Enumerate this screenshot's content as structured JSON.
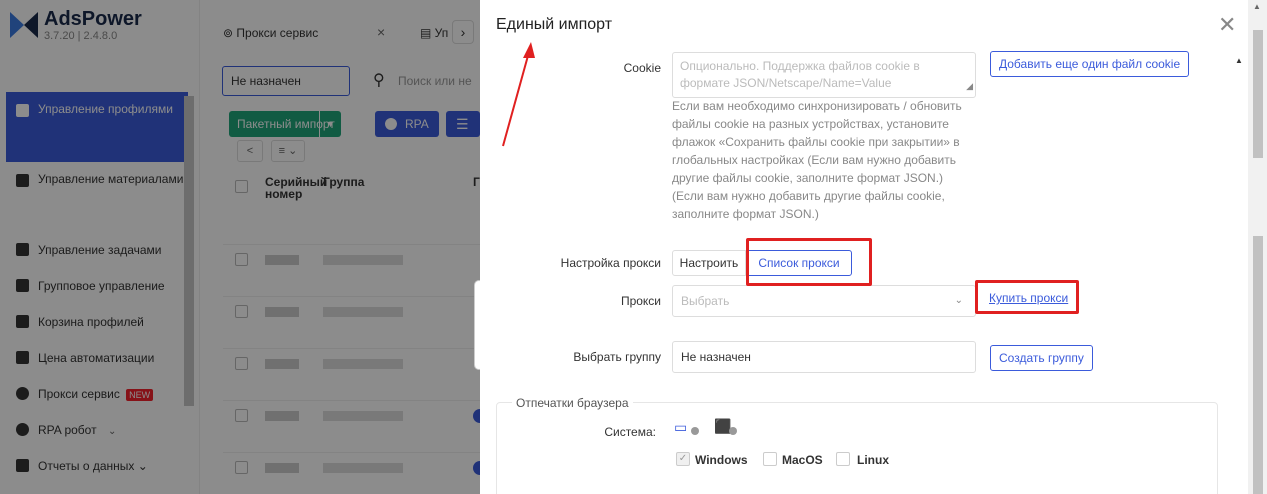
{
  "app": {
    "name": "AdsPower",
    "version": "3.7.20 | 2.4.8.0"
  },
  "sidebar": {
    "items": [
      {
        "label": "Управление профилями",
        "icon": "profile-icon",
        "active": true
      },
      {
        "label": "Управление материалами",
        "icon": "folder-icon"
      },
      {
        "label": "Управление задачами",
        "icon": "tasks-icon"
      },
      {
        "label": "Групповое управление",
        "icon": "group-icon"
      },
      {
        "label": "Корзина профилей",
        "icon": "trash-icon"
      },
      {
        "label": "Цена автоматизации",
        "icon": "price-icon"
      },
      {
        "label": "Прокси сервис",
        "icon": "proxy-icon",
        "badge": "NEW"
      },
      {
        "label": "RPA робот",
        "icon": "robot-icon",
        "chevron": "⌄"
      },
      {
        "label": "Отчеты о данных ⌄",
        "icon": "report-icon"
      }
    ]
  },
  "main": {
    "tabs": [
      {
        "label": "⊚ Прокси сервис"
      },
      {
        "label": "▤ Уп"
      }
    ],
    "tab_close": "×",
    "tab_next": "›",
    "filter_value": "Не назначен",
    "search_placeholder": "Поиск или не",
    "batch_import": "Пакетный импорт",
    "rpa": "RPA",
    "table_headers": {
      "serial": "Серийный номер",
      "group": "Группа",
      "next": "Г"
    }
  },
  "drawer": {
    "title": "Единый импорт",
    "cookie": {
      "label": "Cookie",
      "placeholder": "Опционально. Поддержка файлов cookie в формате JSON/Netscape/Name=Value",
      "help": "Если вам необходимо синхронизировать / обновить файлы cookie на разных устройствах, установите флажок «Сохранить файлы cookie при закрытии» в глобальных настройках (Если вам нужно добавить другие файлы cookie, заполните формат JSON.) (Если вам нужно добавить другие файлы cookie, заполните формат JSON.)",
      "add_button": "Добавить еще один файл cookie"
    },
    "proxy_setup": {
      "label": "Настройка прокси",
      "configure": "Настроить",
      "proxy_list": "Список прокси"
    },
    "proxy": {
      "label": "Прокси",
      "placeholder": "Выбрать",
      "buy_link": "Купить прокси"
    },
    "group": {
      "label": "Выбрать группу",
      "value": "Не назначен",
      "create_button": "Создать группу"
    },
    "fingerprint": {
      "legend": "Отпечатки браузера",
      "system_label": "Система:",
      "os_options": [
        {
          "label": "Windows",
          "checked": true
        },
        {
          "label": "MacOS",
          "checked": false
        },
        {
          "label": "Linux",
          "checked": false
        }
      ]
    }
  },
  "colors": {
    "accent": "#3b5bdb",
    "highlight": "#e02020",
    "green": "#1fa67a"
  }
}
